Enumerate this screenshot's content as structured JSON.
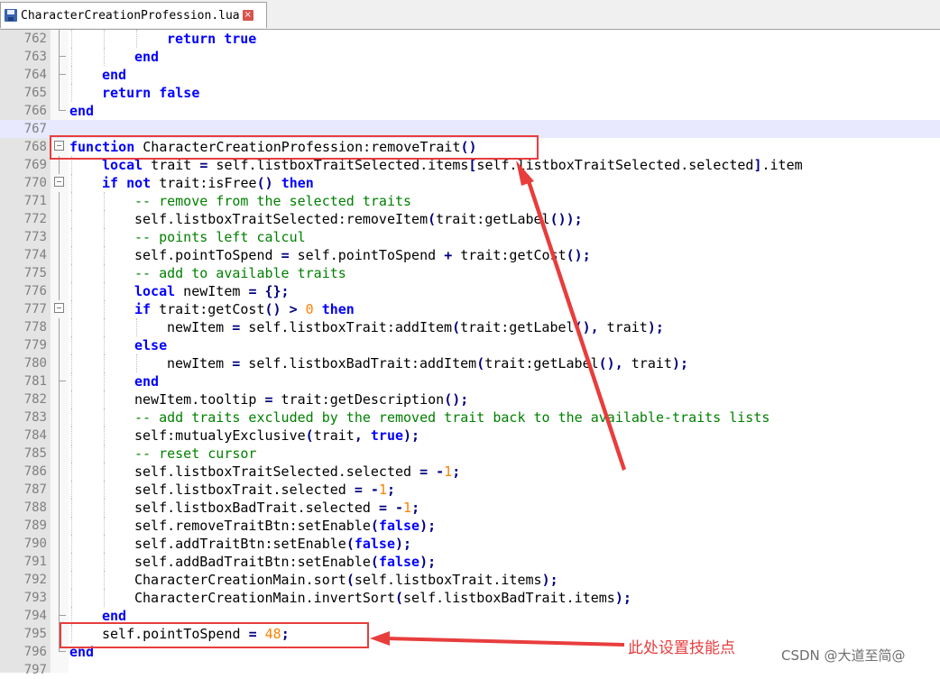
{
  "tab": {
    "filename": "CharacterCreationProfession.lua",
    "close_glyph": "×"
  },
  "editor": {
    "lines": [
      {
        "n": "762",
        "indent": 3,
        "fold": "v",
        "tokens": [
          [
            "kw",
            "return"
          ],
          [
            "tx",
            " "
          ],
          [
            "kw",
            "true"
          ]
        ]
      },
      {
        "n": "763",
        "indent": 2,
        "fold": "e",
        "tokens": [
          [
            "kw",
            "end"
          ]
        ]
      },
      {
        "n": "764",
        "indent": 1,
        "fold": "e",
        "tokens": [
          [
            "kw",
            "end"
          ]
        ]
      },
      {
        "n": "765",
        "indent": 1,
        "fold": "v",
        "tokens": [
          [
            "kw",
            "return"
          ],
          [
            "tx",
            " "
          ],
          [
            "kw",
            "false"
          ]
        ]
      },
      {
        "n": "766",
        "indent": 0,
        "fold": "e",
        "tokens": [
          [
            "kw",
            "end"
          ]
        ]
      },
      {
        "n": "767",
        "indent": 0,
        "fold": "",
        "current": true,
        "tokens": []
      },
      {
        "n": "768",
        "indent": 0,
        "fold": "m",
        "tokens": [
          [
            "kw",
            "function"
          ],
          [
            "tx",
            " CharacterCreationProfession:removeTrait"
          ],
          [
            "op",
            "()"
          ]
        ]
      },
      {
        "n": "769",
        "indent": 1,
        "fold": "v",
        "tokens": [
          [
            "kw",
            "local"
          ],
          [
            "tx",
            " trait "
          ],
          [
            "op",
            "="
          ],
          [
            "tx",
            " self.listboxTraitSelected.items"
          ],
          [
            "op",
            "["
          ],
          [
            "tx",
            "self.listboxTraitSelected.selected"
          ],
          [
            "op",
            "]"
          ],
          [
            "tx",
            ".item"
          ]
        ]
      },
      {
        "n": "770",
        "indent": 1,
        "fold": "m",
        "tokens": [
          [
            "kw",
            "if"
          ],
          [
            "tx",
            " "
          ],
          [
            "kw",
            "not"
          ],
          [
            "tx",
            " trait:isFree"
          ],
          [
            "op",
            "()"
          ],
          [
            "tx",
            " "
          ],
          [
            "kw",
            "then"
          ]
        ]
      },
      {
        "n": "771",
        "indent": 2,
        "fold": "v",
        "tokens": [
          [
            "cm",
            "-- remove from the selected traits"
          ]
        ]
      },
      {
        "n": "772",
        "indent": 2,
        "fold": "v",
        "tokens": [
          [
            "tx",
            "self.listboxTraitSelected:removeItem"
          ],
          [
            "op",
            "("
          ],
          [
            "tx",
            "trait:getLabel"
          ],
          [
            "op",
            "());"
          ]
        ]
      },
      {
        "n": "773",
        "indent": 2,
        "fold": "v",
        "tokens": [
          [
            "cm",
            "-- points left calcul"
          ]
        ]
      },
      {
        "n": "774",
        "indent": 2,
        "fold": "v",
        "tokens": [
          [
            "tx",
            "self.pointToSpend "
          ],
          [
            "op",
            "="
          ],
          [
            "tx",
            " self.pointToSpend "
          ],
          [
            "op",
            "+"
          ],
          [
            "tx",
            " trait:getCost"
          ],
          [
            "op",
            "();"
          ]
        ]
      },
      {
        "n": "775",
        "indent": 2,
        "fold": "v",
        "tokens": [
          [
            "cm",
            "-- add to available traits"
          ]
        ]
      },
      {
        "n": "776",
        "indent": 2,
        "fold": "v",
        "tokens": [
          [
            "kw",
            "local"
          ],
          [
            "tx",
            " newItem "
          ],
          [
            "op",
            "="
          ],
          [
            "tx",
            " "
          ],
          [
            "op",
            "{};"
          ]
        ]
      },
      {
        "n": "777",
        "indent": 2,
        "fold": "m",
        "tokens": [
          [
            "kw",
            "if"
          ],
          [
            "tx",
            " trait:getCost"
          ],
          [
            "op",
            "()"
          ],
          [
            "tx",
            " "
          ],
          [
            "op",
            ">"
          ],
          [
            "tx",
            " "
          ],
          [
            "nm",
            "0"
          ],
          [
            "tx",
            " "
          ],
          [
            "kw",
            "then"
          ]
        ]
      },
      {
        "n": "778",
        "indent": 3,
        "fold": "v",
        "tokens": [
          [
            "tx",
            "newItem "
          ],
          [
            "op",
            "="
          ],
          [
            "tx",
            " self.listboxTrait:addItem"
          ],
          [
            "op",
            "("
          ],
          [
            "tx",
            "trait:getLabel"
          ],
          [
            "op",
            "(),"
          ],
          [
            "tx",
            " trait"
          ],
          [
            "op",
            ");"
          ]
        ]
      },
      {
        "n": "779",
        "indent": 2,
        "fold": "v",
        "tokens": [
          [
            "kw",
            "else"
          ]
        ]
      },
      {
        "n": "780",
        "indent": 3,
        "fold": "v",
        "tokens": [
          [
            "tx",
            "newItem "
          ],
          [
            "op",
            "="
          ],
          [
            "tx",
            " self.listboxBadTrait:addItem"
          ],
          [
            "op",
            "("
          ],
          [
            "tx",
            "trait:getLabel"
          ],
          [
            "op",
            "(),"
          ],
          [
            "tx",
            " trait"
          ],
          [
            "op",
            ");"
          ]
        ]
      },
      {
        "n": "781",
        "indent": 2,
        "fold": "e",
        "tokens": [
          [
            "kw",
            "end"
          ]
        ]
      },
      {
        "n": "782",
        "indent": 2,
        "fold": "v",
        "tokens": [
          [
            "tx",
            "newItem.tooltip "
          ],
          [
            "op",
            "="
          ],
          [
            "tx",
            " trait:getDescription"
          ],
          [
            "op",
            "();"
          ]
        ]
      },
      {
        "n": "783",
        "indent": 2,
        "fold": "v",
        "tokens": [
          [
            "cm",
            "-- add traits excluded by the removed trait back to the available-traits lists"
          ]
        ]
      },
      {
        "n": "784",
        "indent": 2,
        "fold": "v",
        "tokens": [
          [
            "tx",
            "self:mutualyExclusive"
          ],
          [
            "op",
            "("
          ],
          [
            "tx",
            "trait"
          ],
          [
            "op",
            ","
          ],
          [
            "tx",
            " "
          ],
          [
            "kw",
            "true"
          ],
          [
            "op",
            ");"
          ]
        ]
      },
      {
        "n": "785",
        "indent": 2,
        "fold": "v",
        "tokens": [
          [
            "cm",
            "-- reset cursor"
          ]
        ]
      },
      {
        "n": "786",
        "indent": 2,
        "fold": "v",
        "tokens": [
          [
            "tx",
            "self.listboxTraitSelected.selected "
          ],
          [
            "op",
            "="
          ],
          [
            "tx",
            " "
          ],
          [
            "op",
            "-"
          ],
          [
            "nm",
            "1"
          ],
          [
            "op",
            ";"
          ]
        ]
      },
      {
        "n": "787",
        "indent": 2,
        "fold": "v",
        "tokens": [
          [
            "tx",
            "self.listboxTrait.selected "
          ],
          [
            "op",
            "="
          ],
          [
            "tx",
            " "
          ],
          [
            "op",
            "-"
          ],
          [
            "nm",
            "1"
          ],
          [
            "op",
            ";"
          ]
        ]
      },
      {
        "n": "788",
        "indent": 2,
        "fold": "v",
        "tokens": [
          [
            "tx",
            "self.listboxBadTrait.selected "
          ],
          [
            "op",
            "="
          ],
          [
            "tx",
            " "
          ],
          [
            "op",
            "-"
          ],
          [
            "nm",
            "1"
          ],
          [
            "op",
            ";"
          ]
        ]
      },
      {
        "n": "789",
        "indent": 2,
        "fold": "v",
        "tokens": [
          [
            "tx",
            "self.removeTraitBtn:setEnable"
          ],
          [
            "op",
            "("
          ],
          [
            "kw",
            "false"
          ],
          [
            "op",
            ");"
          ]
        ]
      },
      {
        "n": "790",
        "indent": 2,
        "fold": "v",
        "tokens": [
          [
            "tx",
            "self.addTraitBtn:setEnable"
          ],
          [
            "op",
            "("
          ],
          [
            "kw",
            "false"
          ],
          [
            "op",
            ");"
          ]
        ]
      },
      {
        "n": "791",
        "indent": 2,
        "fold": "v",
        "tokens": [
          [
            "tx",
            "self.addBadTraitBtn:setEnable"
          ],
          [
            "op",
            "("
          ],
          [
            "kw",
            "false"
          ],
          [
            "op",
            ");"
          ]
        ]
      },
      {
        "n": "792",
        "indent": 2,
        "fold": "v",
        "tokens": [
          [
            "tx",
            "CharacterCreationMain.sort"
          ],
          [
            "op",
            "("
          ],
          [
            "tx",
            "self.listboxTrait.items"
          ],
          [
            "op",
            ");"
          ]
        ]
      },
      {
        "n": "793",
        "indent": 2,
        "fold": "v",
        "tokens": [
          [
            "tx",
            "CharacterCreationMain.invertSort"
          ],
          [
            "op",
            "("
          ],
          [
            "tx",
            "self.listboxBadTrait.items"
          ],
          [
            "op",
            ");"
          ]
        ]
      },
      {
        "n": "794",
        "indent": 1,
        "fold": "e",
        "tokens": [
          [
            "kw",
            "end"
          ]
        ]
      },
      {
        "n": "795",
        "indent": 1,
        "fold": "v",
        "tokens": [
          [
            "tx",
            "self.pointToSpend "
          ],
          [
            "op",
            "="
          ],
          [
            "tx",
            " "
          ],
          [
            "nm",
            "48"
          ],
          [
            "op",
            ";"
          ]
        ]
      },
      {
        "n": "796",
        "indent": 0,
        "fold": "e",
        "tokens": [
          [
            "kw",
            "end"
          ]
        ]
      },
      {
        "n": "797",
        "indent": 0,
        "fold": "",
        "tokens": []
      }
    ]
  },
  "annotation": {
    "label": "此处设置技能点",
    "color": "#e83d3d"
  },
  "watermark": "CSDN @大道至简@",
  "colors": {
    "keyword": "#0000ff",
    "comment": "#008000",
    "number": "#ff8000",
    "operator": "#000080",
    "current_line": "#e8e8ff"
  },
  "icons": {
    "tab_icon": "save-icon",
    "tab_close": "close-icon"
  }
}
